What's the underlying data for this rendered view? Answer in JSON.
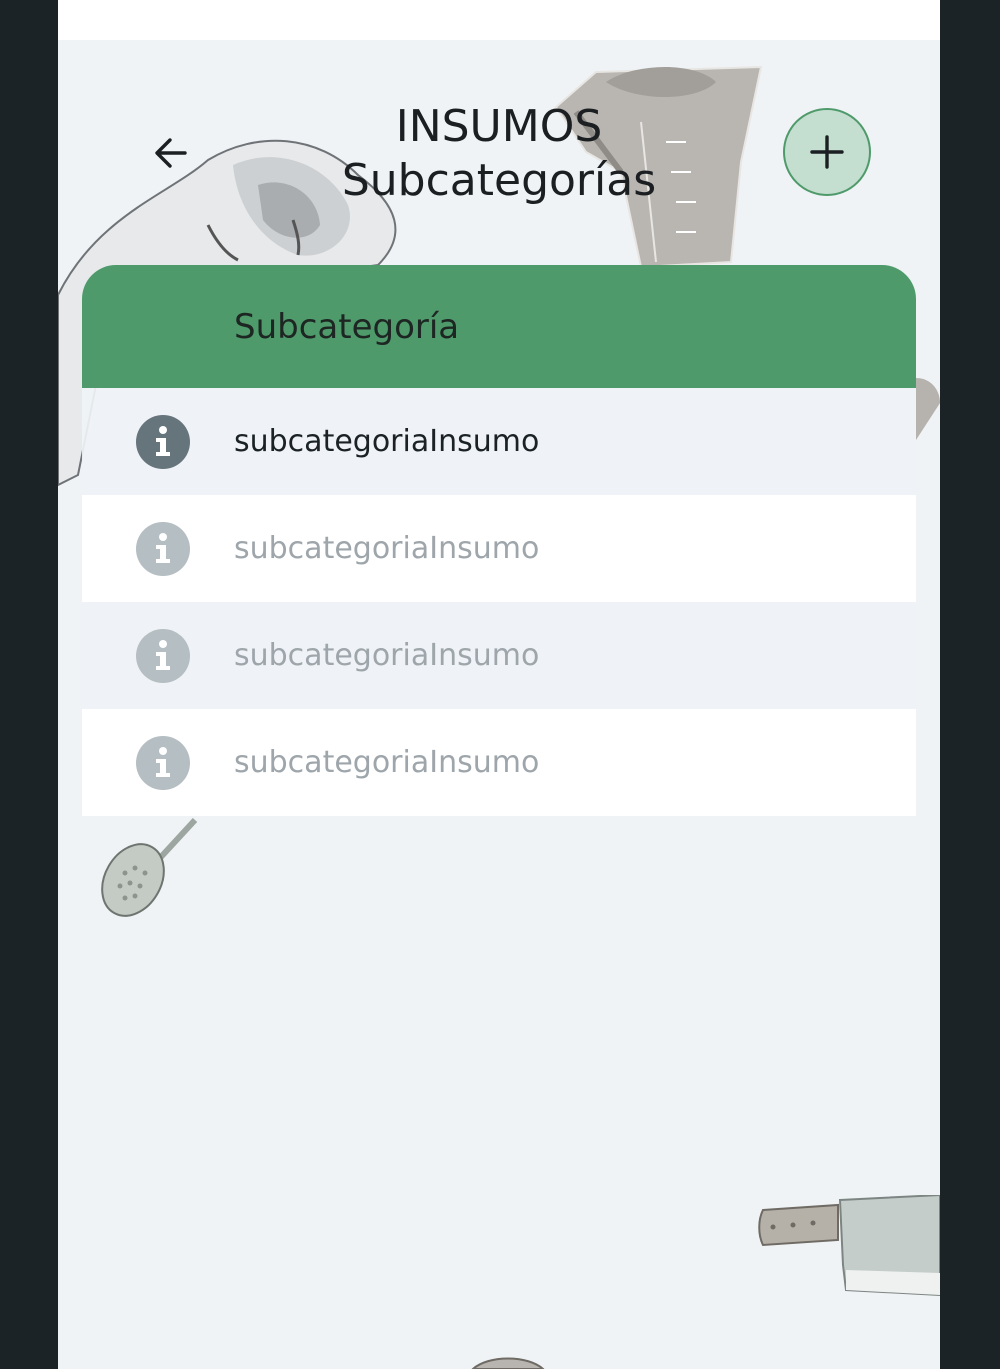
{
  "header": {
    "title_line1": "INSUMOS",
    "title_line2": "Subcategorías"
  },
  "actions": {
    "back_icon": "arrow-left-icon",
    "add_icon": "plus-icon"
  },
  "table": {
    "column_header": "Subcategoría",
    "rows": [
      {
        "label": "subcategoriaInsumo",
        "icon": "info-icon",
        "state": "active"
      },
      {
        "label": "subcategoriaInsumo",
        "icon": "info-icon",
        "state": "dim"
      },
      {
        "label": "subcategoriaInsumo",
        "icon": "info-icon",
        "state": "dim"
      },
      {
        "label": "subcategoriaInsumo",
        "icon": "info-icon",
        "state": "dim"
      }
    ]
  },
  "colors": {
    "accent_green": "#4f9a6a",
    "add_button_fill": "#c4ded0",
    "background": "#eff3f6",
    "frame": "#1c2326"
  }
}
